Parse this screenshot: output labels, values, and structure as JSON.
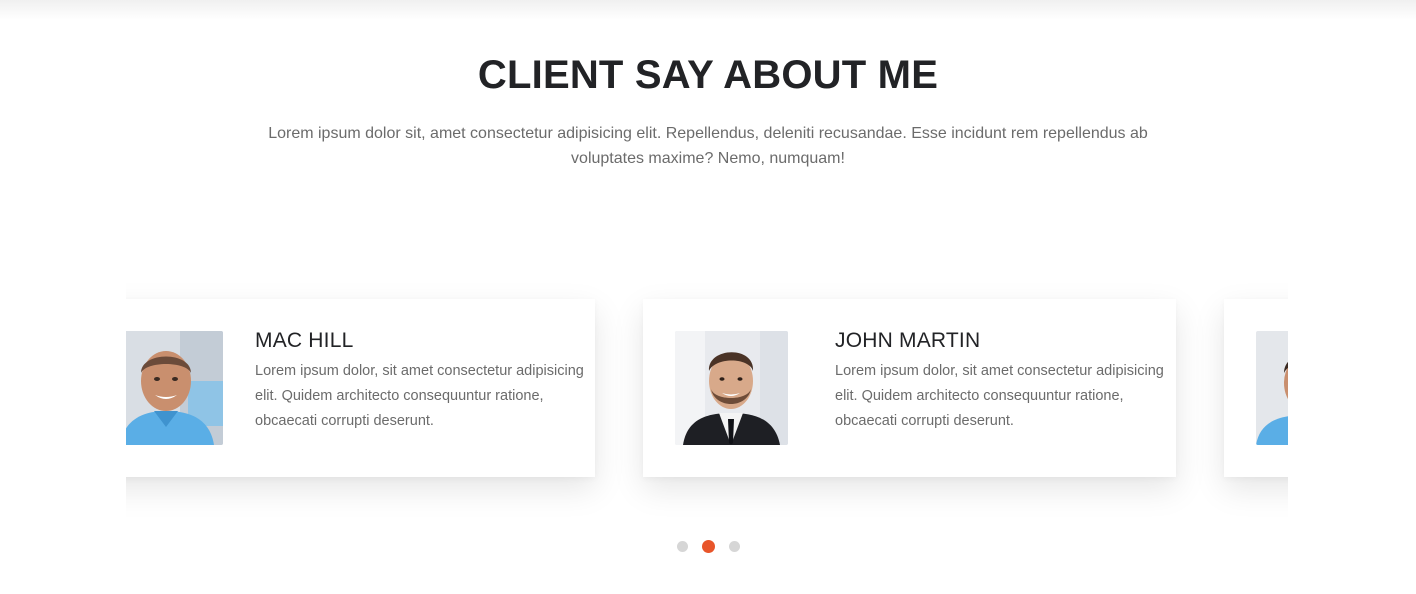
{
  "section": {
    "title": "CLIENT SAY ABOUT ME",
    "description": "Lorem ipsum dolor sit, amet consectetur adipisicing elit. Repellendus, deleniti recusandae. Esse incidunt rem repellendus ab voluptates maxime? Nemo, numquam!"
  },
  "testimonials": [
    {
      "name": "MAC HILL",
      "quote": "Lorem ipsum dolor, sit amet consectetur adipisicing elit. Quidem architecto consequuntur ratione, obcaecati corrupti deserunt."
    },
    {
      "name": "JOHN MARTIN",
      "quote": "Lorem ipsum dolor, sit amet consectetur adipisicing elit. Quidem architecto consequuntur ratione, obcaecati corrupti deserunt."
    },
    {
      "name": "",
      "quote": ""
    }
  ],
  "pagination": {
    "count": 3,
    "active_index": 1,
    "active_color": "#e8552a",
    "inactive_color": "#d6d6d6"
  },
  "colors": {
    "heading": "#222326",
    "body_text": "#6b6b6b",
    "accent": "#e8552a",
    "background": "#ffffff"
  }
}
